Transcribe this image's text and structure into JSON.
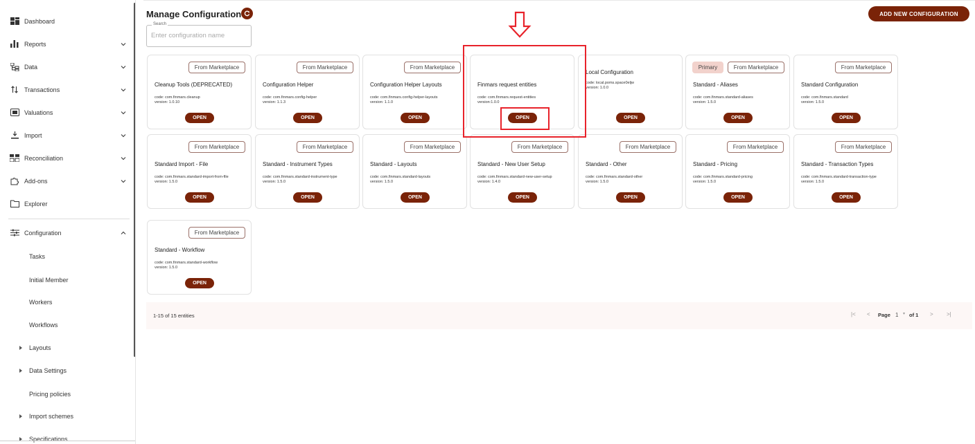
{
  "sidebar": {
    "items": [
      {
        "label": "Dashboard",
        "icon": "dashboard-icon",
        "caret": false
      },
      {
        "label": "Reports",
        "icon": "bar-chart-icon",
        "caret": true
      },
      {
        "label": "Data",
        "icon": "data-icon",
        "caret": true
      },
      {
        "label": "Transactions",
        "icon": "transactions-icon",
        "caret": true
      },
      {
        "label": "Valuations",
        "icon": "valuations-icon",
        "caret": true
      },
      {
        "label": "Import",
        "icon": "import-icon",
        "caret": true
      },
      {
        "label": "Reconciliation",
        "icon": "reconciliation-icon",
        "caret": true
      },
      {
        "label": "Add-ons",
        "icon": "puzzle-icon",
        "caret": true
      },
      {
        "label": "Explorer",
        "icon": "folder-icon",
        "caret": false
      },
      {
        "label": "Configuration",
        "icon": "sliders-icon",
        "caret": "up"
      }
    ],
    "sub_items": [
      {
        "label": "Tasks"
      },
      {
        "label": "Initial Member"
      },
      {
        "label": "Workers"
      },
      {
        "label": "Workflows"
      },
      {
        "label": "Layouts",
        "expandable": true
      },
      {
        "label": "Data Settings",
        "expandable": true
      },
      {
        "label": "Pricing policies"
      },
      {
        "label": "Import schemes",
        "expandable": true
      },
      {
        "label": "Specifications",
        "expandable": true
      }
    ]
  },
  "header": {
    "title": "Manage Configuration",
    "add_button": "ADD NEW CONFIGURATION",
    "search_label": "Search",
    "search_placeholder": "Enter configuration name",
    "search_value": ""
  },
  "open_label": "OPEN",
  "marketplace_label": "From Marketplace",
  "primary_label": "Primary",
  "cards": [
    {
      "title": "Cleanup Tools (DEPRECATED)",
      "code": "code: com.finmars.cleanup",
      "version": "version: 1.0.10",
      "marketplace": true,
      "primary": false
    },
    {
      "title": "Configuration Helper",
      "code": "code: com.finmars.config-helper",
      "version": "version: 1.1.3",
      "marketplace": true,
      "primary": false
    },
    {
      "title": "Configuration Helper Layouts",
      "code": "code: com.finmars.config-helper-layouts",
      "version": "version: 1.1.0",
      "marketplace": true,
      "primary": false
    },
    {
      "title": "Finmars request entities",
      "code": "code: com.finmars.request-entities",
      "version": "version:1.0.0",
      "marketplace": false,
      "primary": false
    },
    {
      "title": "Local Configuration",
      "code": "code: local.poms.space0eljw",
      "version": "version: 1.0.0",
      "marketplace": false,
      "primary": false
    },
    {
      "title": "Standard - Aliases",
      "code": "code: com.finmars.standard-aliases",
      "version": "version: 1.5.0",
      "marketplace": true,
      "primary": true
    },
    {
      "title": "Standard Configuration",
      "code": "code: com.finmars.standard",
      "version": "version: 1.5.0",
      "marketplace": true,
      "primary": false
    },
    {
      "title": "Standard Import - File",
      "code": "code: com.finmars.standard-import-from-file",
      "version": "version: 1.5.0",
      "marketplace": true,
      "primary": false
    },
    {
      "title": "Standard - Instrument Types",
      "code": "code: com.finmars.standard-instrument-type",
      "version": "version: 1.5.0",
      "marketplace": true,
      "primary": false
    },
    {
      "title": "Standard - Layouts",
      "code": "code: com.finmars.standard-layouts",
      "version": "version: 1.5.0",
      "marketplace": true,
      "primary": false
    },
    {
      "title": "Standard - New User Setup",
      "code": "code: com.finmars.standard-new-user-setup",
      "version": "version: 1.4.0",
      "marketplace": true,
      "primary": false
    },
    {
      "title": "Standard - Other",
      "code": "code: com.finmars.standard-other",
      "version": "version: 1.5.0",
      "marketplace": true,
      "primary": false
    },
    {
      "title": "Standard - Pricing",
      "code": "code: com.finmars.standard-pricing",
      "version": "version: 1.5.0",
      "marketplace": true,
      "primary": false
    },
    {
      "title": "Standard - Transaction Types",
      "code": "code: com.finmars.standard-transaction-type",
      "version": "version: 1.5.0",
      "marketplace": true,
      "primary": false
    },
    {
      "title": "Standard - Workflow",
      "code": "code: com.finmars.standard-workflow",
      "version": "version: 1.5.0",
      "marketplace": true,
      "primary": false
    }
  ],
  "footer": {
    "count": "1-15 of 15 entities",
    "page_label": "Page",
    "page_number": "1",
    "of_label": "of 1"
  },
  "colors": {
    "accent": "#7a2308",
    "primary_badge": "#f2d2cc",
    "annotation": "#e8222a"
  }
}
